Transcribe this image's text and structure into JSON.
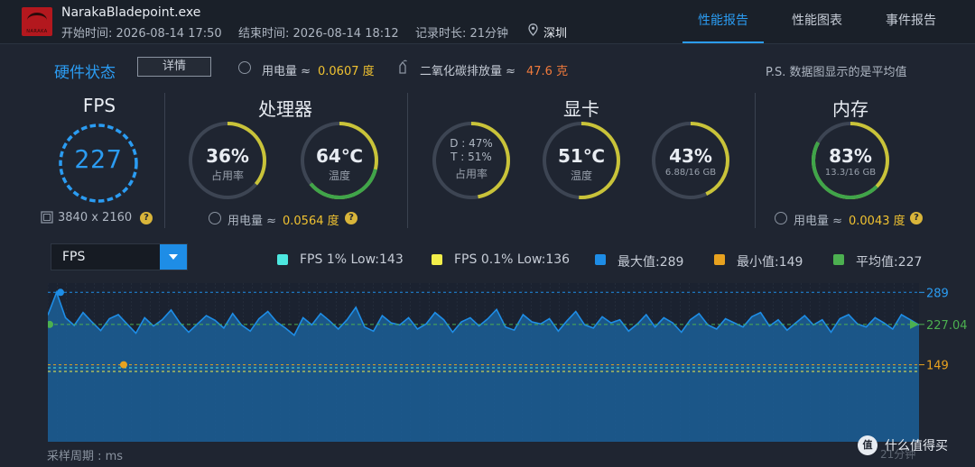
{
  "header": {
    "app_name": "NarakaBladepoint.exe",
    "logo_text": "NARAKA",
    "start_time": "开始时间: 2026-08-14 17:50",
    "end_time": "结束时间: 2026-08-14 18:12",
    "duration": "记录时长: 21分钟",
    "location": "深圳",
    "tabs": [
      "性能报告",
      "性能图表",
      "事件报告"
    ],
    "active_tab": "性能报告"
  },
  "status": {
    "title": "硬件状态",
    "details_label": "详情",
    "power_label": "用电量 ≈",
    "power_value": "0.0607 度",
    "co2_label": "二氧化碳排放量 ≈",
    "co2_value": "47.6 克",
    "note": "P.S. 数据图显示的是平均值"
  },
  "fps": {
    "title": "FPS",
    "value": "227",
    "resolution": "3840 x 2160"
  },
  "cpu": {
    "title": "处理器",
    "usage": {
      "value": "36%",
      "label": "占用率",
      "fraction": 0.36
    },
    "temp": {
      "value": "64℃",
      "label": "温度",
      "fraction": 0.64
    },
    "power_label": "用电量 ≈",
    "power_value": "0.0564 度"
  },
  "gpu": {
    "title": "显卡",
    "usage": {
      "d": "D : 47%",
      "t": "T : 51%",
      "label": "占用率",
      "fraction": 0.47
    },
    "temp": {
      "value": "51℃",
      "label": "温度",
      "fraction": 0.51
    },
    "vram": {
      "value": "43%",
      "label": "6.88/16 GB",
      "fraction": 0.43
    }
  },
  "memory": {
    "title": "内存",
    "usage": {
      "value": "83%",
      "label": "13.3/16 GB",
      "fraction": 0.83
    },
    "power_label": "用电量 ≈",
    "power_value": "0.0043 度"
  },
  "chart_controls": {
    "selected_metric": "FPS",
    "legend": [
      {
        "label": "FPS 1% Low:143",
        "color": "#4de8e0"
      },
      {
        "label": "FPS 0.1% Low:136",
        "color": "#f2ee4a"
      },
      {
        "label": "最大值:289",
        "color": "#1e8de6"
      },
      {
        "label": "最小值:149",
        "color": "#e8a21f"
      },
      {
        "label": "平均值:227",
        "color": "#4cb050"
      }
    ]
  },
  "chart_data": {
    "type": "area",
    "x_range_minutes": [
      0,
      21
    ],
    "ylim": [
      0,
      300
    ],
    "max": 289,
    "min": 149,
    "avg": 227.04,
    "low_1pct": 143,
    "low_01pct": 136,
    "y_tick_labels": [
      "289",
      "227.04",
      "149"
    ],
    "x_end_label": "21分钟",
    "series": [
      {
        "values": [
          245,
          289,
          240,
          225,
          250,
          232,
          215,
          238,
          246,
          228,
          210,
          240,
          224,
          236,
          255,
          230,
          212,
          228,
          244,
          235,
          220,
          248,
          226,
          214,
          238,
          252,
          232,
          220,
          206,
          240,
          226,
          248,
          234,
          218,
          236,
          260,
          222,
          214,
          244,
          230,
          226,
          240,
          218,
          228,
          250,
          236,
          212,
          232,
          240,
          224,
          238,
          256,
          222,
          216,
          246,
          232,
          228,
          238,
          214,
          234,
          252,
          226,
          220,
          242,
          230,
          236,
          214,
          228,
          246,
          222,
          240,
          230,
          212,
          236,
          248,
          226,
          218,
          238,
          230,
          222,
          242,
          250,
          224,
          236,
          216,
          230,
          244,
          226,
          236,
          212,
          238,
          246,
          228,
          222,
          240,
          230,
          218,
          246,
          236,
          226
        ]
      }
    ]
  },
  "footer": {
    "sample_period": "采样周期 : ms",
    "time_unit": "21分钟",
    "watermark": "什么值得买"
  },
  "colors": {
    "accent": "#2b9cf2",
    "ring_track": "#3d4553",
    "ring_green": "#3fa54a",
    "ring_yellow": "#c9c339",
    "value_yellow": "#f0c231",
    "value_orange": "#f07a3c"
  }
}
